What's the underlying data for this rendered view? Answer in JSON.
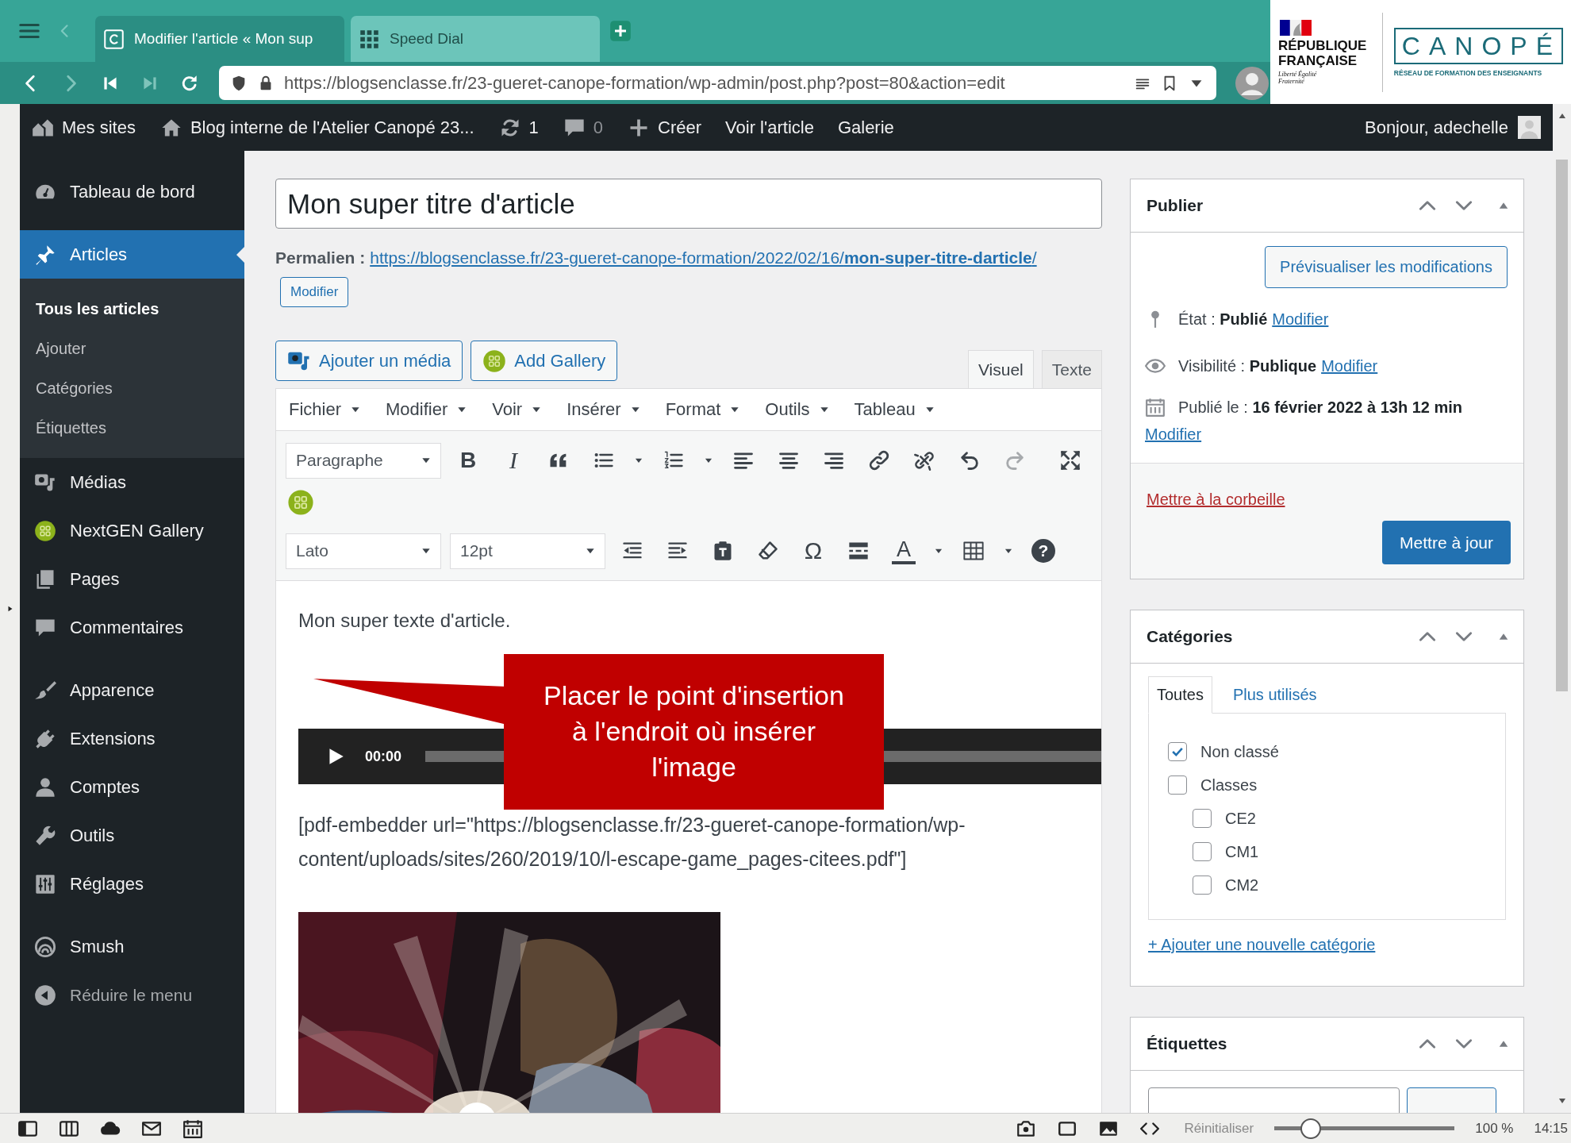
{
  "browser": {
    "tabs": [
      {
        "title": "Modifier l'article « Mon sup",
        "selected": true
      },
      {
        "title": "Speed Dial",
        "selected": false
      }
    ],
    "forward_disabled": true,
    "address": "https://blogsenclasse.fr/23-gueret-canope-formation/wp-admin/post.php?post=80&action=edit"
  },
  "logos": {
    "republique": "RÉPUBLIQUE FRANÇAISE",
    "motto": "Liberté Égalité Fraternité",
    "canope": "CANOPÉ",
    "canope_tagline": "RÉSEAU DE FORMATION DES ENSEIGNANTS"
  },
  "admin_bar": {
    "items": [
      {
        "label": "Mes sites",
        "dimmed": false
      },
      {
        "label": "Blog interne de l'Atelier Canopé 23...",
        "dimmed": false
      },
      {
        "label": "1",
        "dimmed": false
      },
      {
        "label": "0",
        "dimmed": true
      },
      {
        "label": "Créer",
        "dimmed": false
      },
      {
        "label": "Voir l'article",
        "dimmed": false
      },
      {
        "label": "Galerie",
        "dimmed": false
      }
    ],
    "greeting": "Bonjour, adechelle"
  },
  "sidebar": {
    "groups": [
      [
        {
          "label": "Tableau de bord",
          "selected": false
        }
      ],
      [
        {
          "label": "Articles",
          "selected": true,
          "children": [
            {
              "label": "Tous les articles",
              "selected": true
            },
            {
              "label": "Ajouter",
              "selected": false
            },
            {
              "label": "Catégories",
              "selected": false
            },
            {
              "label": "Étiquettes",
              "selected": false
            }
          ]
        },
        {
          "label": "Médias",
          "selected": false
        },
        {
          "label": "NextGEN Gallery",
          "selected": false
        },
        {
          "label": "Pages",
          "selected": false
        },
        {
          "label": "Commentaires",
          "selected": false
        }
      ],
      [
        {
          "label": "Apparence",
          "selected": false
        },
        {
          "label": "Extensions",
          "selected": false
        },
        {
          "label": "Comptes",
          "selected": false
        },
        {
          "label": "Outils",
          "selected": false
        },
        {
          "label": "Réglages",
          "selected": false
        }
      ],
      [
        {
          "label": "Smush",
          "selected": false
        }
      ]
    ],
    "collapse": "Réduire le menu"
  },
  "editor": {
    "title": "Mon super titre d'article",
    "permalink_label": "Permalien :",
    "permalink": "https://blogsenclasse.fr/23-gueret-canope-formation/2022/02/16/**mon-super-titre-darticle**/",
    "permalink_button": "Modifier",
    "media_buttons": [
      "Ajouter un média",
      "Add Gallery"
    ],
    "mode_tabs": [
      {
        "label": "Visuel",
        "selected": true
      },
      {
        "label": "Texte",
        "selected": false
      }
    ],
    "menus": [
      "Fichier",
      "Modifier",
      "Voir",
      "Insérer",
      "Format",
      "Outils",
      "Tableau"
    ],
    "format": "Paragraphe",
    "font": "Lato",
    "size": "12pt",
    "glyphs": {
      "bold": "B",
      "italic": "I",
      "special": "Ω",
      "text_color": "A",
      "help": "?"
    },
    "redo_disabled": true,
    "paragraph": "Mon super texte d'article.",
    "audio_time": "00:00",
    "shortcode": "[pdf-embedder url=\"https://blogsenclasse.fr/23-gueret-canope-formation/wp-content/uploads/sites/260/2019/10/l-escape-game_pages-citees.pdf\"]",
    "image": {
      "kind": "picture"
    }
  },
  "callout": {
    "text": "Placer le point d'insertion à l'endroit où insérer l'image"
  },
  "publish_box": {
    "title": "Publier",
    "preview_button": "Prévisualiser les modifications",
    "rows": [
      {
        "text": "État : **Publié**",
        "link": "Modifier"
      },
      {
        "text": "Visibilité : **Publique**",
        "link": "Modifier"
      },
      {
        "text": "Publié le : **16 février 2022 à 13h 12 min**",
        "link": "Modifier"
      }
    ],
    "trash_link": "Mettre à la corbeille",
    "update_button": "Mettre à jour"
  },
  "categories_box": {
    "title": "Catégories",
    "tabs": [
      {
        "label": "Toutes",
        "selected": true
      },
      {
        "label": "Plus utilisés",
        "selected": false
      }
    ],
    "items": [
      {
        "label": "Non classé",
        "checked": true
      },
      {
        "label": "Classes",
        "checked": false,
        "children": [
          {
            "label": "CE2",
            "checked": false
          },
          {
            "label": "CM1",
            "checked": false
          },
          {
            "label": "CM2",
            "checked": false
          }
        ]
      }
    ],
    "add_link": "+ Ajouter une nouvelle catégorie"
  },
  "tags_box": {
    "title": "Étiquettes"
  },
  "status_bar": {
    "reset": "Réinitialiser",
    "zoom_slider": {
      "level": 0.2
    },
    "zoom": "100 %",
    "clock": "14:15"
  }
}
